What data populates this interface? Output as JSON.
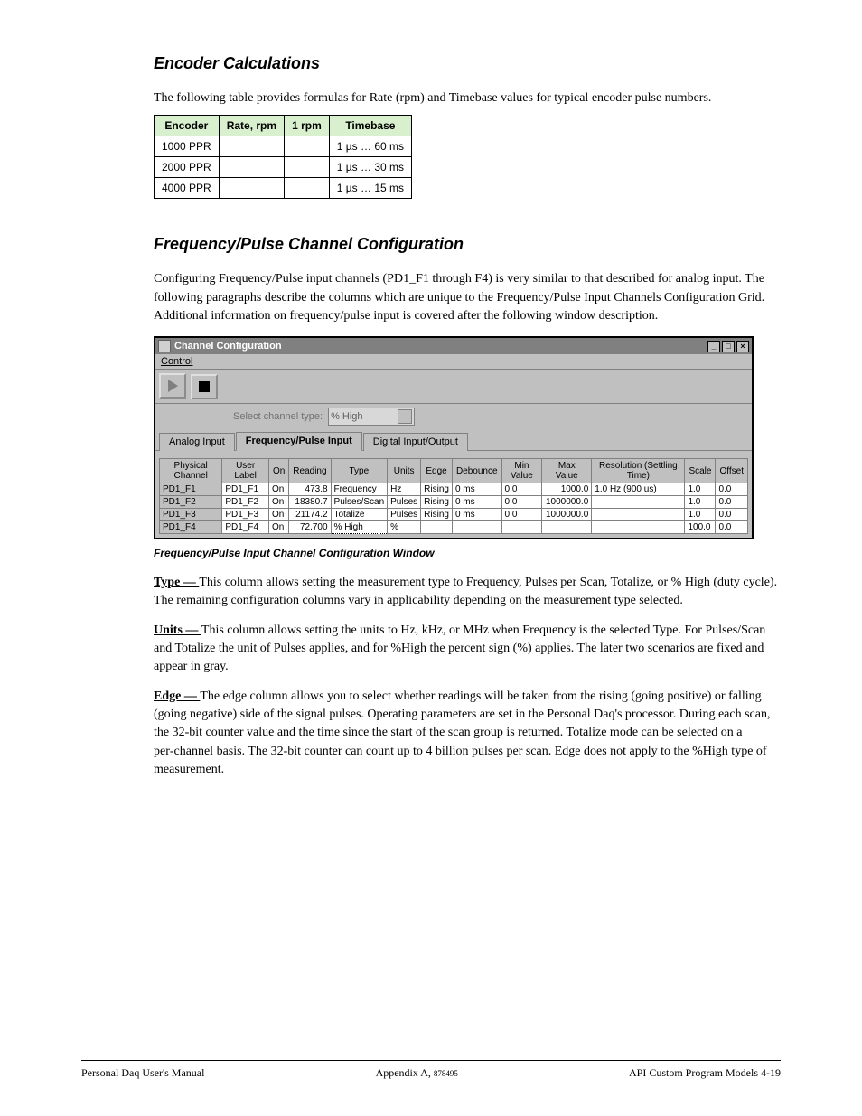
{
  "section_title": "Encoder Calculations",
  "intro_para": "The following table provides formulas for Rate (rpm) and Timebase values for typical encoder pulse numbers.",
  "mini_table": {
    "headers": [
      "Encoder",
      "Rate, rpm",
      "1 rpm",
      "Timebase"
    ],
    "rows": [
      [
        "1000 PPR",
        "",
        "",
        "1 µs … 60 ms"
      ],
      [
        "2000 PPR",
        "",
        "",
        "1 µs … 30 ms"
      ],
      [
        "4000 PPR",
        "",
        "",
        "1 µs … 15 ms"
      ]
    ]
  },
  "freq_heading": "Frequency/Pulse Channel Configuration",
  "freq_desc_para": "Configuring Frequency/Pulse input channels (PD1_F1 through F4) is very similar to that described for analog input. The following paragraphs describe the columns which are unique to the Frequency/Pulse Input Channels Configuration Grid. Additional information on frequency/pulse input is covered after the following window description.",
  "win": {
    "title": "Channel Configuration",
    "menu": "Control",
    "sel_label": "Select channel type:",
    "sel_value": "% High",
    "tabs": [
      "Analog Input",
      "Frequency/Pulse Input",
      "Digital Input/Output"
    ],
    "active_tab": 1,
    "headers": [
      "Physical Channel",
      "User Label",
      "On",
      "Reading",
      "Type",
      "Units",
      "Edge",
      "Debounce",
      "Min Value",
      "Max Value",
      "Resolution (Settling Time)",
      "Scale",
      "Offset"
    ],
    "rows": [
      [
        "PD1_F1",
        "PD1_F1",
        "On",
        "473.8",
        "Frequency",
        "Hz",
        "Rising",
        "0 ms",
        "0.0",
        "1000.0",
        "1.0 Hz (900 us)",
        "1.0",
        "0.0"
      ],
      [
        "PD1_F2",
        "PD1_F2",
        "On",
        "18380.7",
        "Pulses/Scan",
        "Pulses",
        "Rising",
        "0 ms",
        "0.0",
        "1000000.0",
        "",
        "1.0",
        "0.0"
      ],
      [
        "PD1_F3",
        "PD1_F3",
        "On",
        "21174.2",
        "Totalize",
        "Pulses",
        "Rising",
        "0 ms",
        "0.0",
        "1000000.0",
        "",
        "1.0",
        "0.0"
      ],
      [
        "PD1_F4",
        "PD1_F4",
        "On",
        "72.700",
        "% High",
        "%",
        "",
        "",
        "",
        "",
        "",
        "100.0",
        "0.0"
      ]
    ]
  },
  "caption": "Frequency/Pulse Input Channel Configuration Window",
  "para_type_label": "Type — ",
  "para_type": "This column allows setting the measurement type to Frequency, Pulses per Scan, Totalize, or % High (duty cycle). The remaining configuration columns vary in applicability depending on the measurement type selected.",
  "para_units_label": "Units — ",
  "para_units": "This column allows setting the units to Hz, kHz, or MHz when Frequency is the selected Type. For Pulses/Scan and Totalize the unit of Pulses applies, and for %High the percent sign (%) applies. The later two scenarios are fixed and appear in gray.",
  "para_edge_label": "Edge — ",
  "para_edge": "The edge column allows you to select whether readings will be taken from the rising (going positive) or falling (going negative) side of the signal pulses. Operating parameters are set in the Personal Daq's processor. During each scan, the 32‑bit counter value and the time since the start of the scan group is returned. Totalize mode can be selected on a per‑channel basis. The 32‑bit counter can count up to 4 billion pulses per scan. Edge does not apply to the %High type of measurement.",
  "footer_left": "Personal Daq User's Manual",
  "footer_center": "Appendix A,",
  "footer_right": "API Custom Program Models    4-19",
  "docnum": "878495"
}
